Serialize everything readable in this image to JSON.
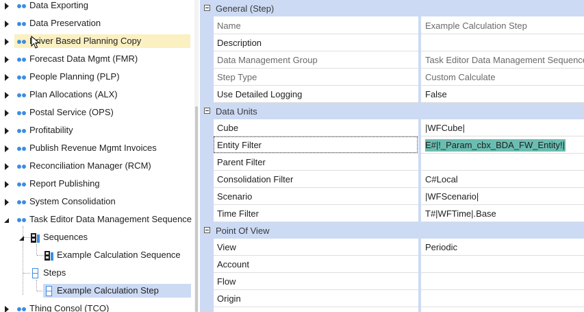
{
  "tree": {
    "items": [
      {
        "label": "Data Exporting"
      },
      {
        "label": "Data Preservation"
      },
      {
        "label": "Driver Based Planning Copy"
      },
      {
        "label": "Forecast Data Mgmt (FMR)"
      },
      {
        "label": "People Planning (PLP)"
      },
      {
        "label": "Plan Allocations (ALX)"
      },
      {
        "label": "Postal Service (OPS)"
      },
      {
        "label": "Profitability"
      },
      {
        "label": "Publish Revenue Mgmt Invoices"
      },
      {
        "label": "Reconciliation Manager (RCM)"
      },
      {
        "label": "Report Publishing"
      },
      {
        "label": "System Consolidation"
      },
      {
        "label": "Task Editor Data Management Sequence"
      },
      {
        "label": "Sequences"
      },
      {
        "label": "Example Calculation Sequence"
      },
      {
        "label": "Steps"
      },
      {
        "label": "Example Calculation Step"
      },
      {
        "label": "Thing Consol (TCO)"
      }
    ]
  },
  "grid": {
    "categories": [
      {
        "label": "General (Step)"
      },
      {
        "label": "Data Units"
      },
      {
        "label": "Point Of View"
      }
    ],
    "rows": [
      {
        "name": "Name",
        "value": "Example Calculation Step"
      },
      {
        "name": "Description",
        "value": ""
      },
      {
        "name": "Data Management Group",
        "value": "Task Editor Data Management Sequence"
      },
      {
        "name": "Step Type",
        "value": "Custom Calculate"
      },
      {
        "name": "Use Detailed Logging",
        "value": "False"
      },
      {
        "name": "Cube",
        "value": "|WFCube|"
      },
      {
        "name": "Entity Filter",
        "value": "E#|!_Param_cbx_BDA_FW_Entity!|"
      },
      {
        "name": "Parent Filter",
        "value": ""
      },
      {
        "name": "Consolidation Filter",
        "value": "C#Local"
      },
      {
        "name": "Scenario",
        "value": "|WFScenario|"
      },
      {
        "name": "Time Filter",
        "value": "T#|WFTime|.Base"
      },
      {
        "name": "View",
        "value": "Periodic"
      },
      {
        "name": "Account",
        "value": ""
      },
      {
        "name": "Flow",
        "value": ""
      },
      {
        "name": "Origin",
        "value": ""
      }
    ]
  },
  "colors": {
    "category_band": "#ccdaf4",
    "tree_hover": "#fbf0c2",
    "tree_selected": "#ccdaf4",
    "value_highlight": "#6abdb0",
    "icon_blue": "#3d8de0"
  }
}
